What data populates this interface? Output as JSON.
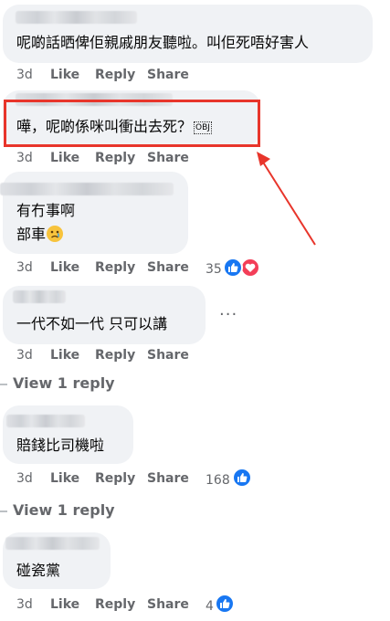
{
  "colors": {
    "bubble": "#f0f2f5",
    "meta": "#65676b",
    "like": "#1877f2",
    "love": "#f33e58",
    "highlight": "#e8352b"
  },
  "comments": [
    {
      "text": "呢啲話晒俾佢親戚朋友聽啦。叫佢死唔好害人",
      "time": "3d",
      "like": "Like",
      "reply": "Reply",
      "share": "Share"
    },
    {
      "text": "嘩，呢啲係咪叫衝出去死？",
      "badge": "OBJ",
      "time": "3d",
      "like": "Like",
      "reply": "Reply",
      "share": "Share"
    },
    {
      "line1": "有冇事啊",
      "line2": "部車",
      "emoji": "sad-face-emoji",
      "time": "3d",
      "like": "Like",
      "reply": "Reply",
      "share": "Share",
      "count": "35"
    },
    {
      "text": "一代不如一代 只可以講",
      "more": "···",
      "time": "3d",
      "like": "Like",
      "reply": "Reply",
      "share": "Share"
    },
    {
      "text": "賠錢比司機啦",
      "time": "3d",
      "like": "Like",
      "reply": "Reply",
      "share": "Share",
      "count": "168"
    },
    {
      "text": "碰瓷黨",
      "time": "3d",
      "like": "Like",
      "reply": "Reply",
      "share": "Share",
      "count": "4"
    }
  ],
  "view_reply_1": "View 1 reply",
  "view_reply_2": "View 1 reply"
}
